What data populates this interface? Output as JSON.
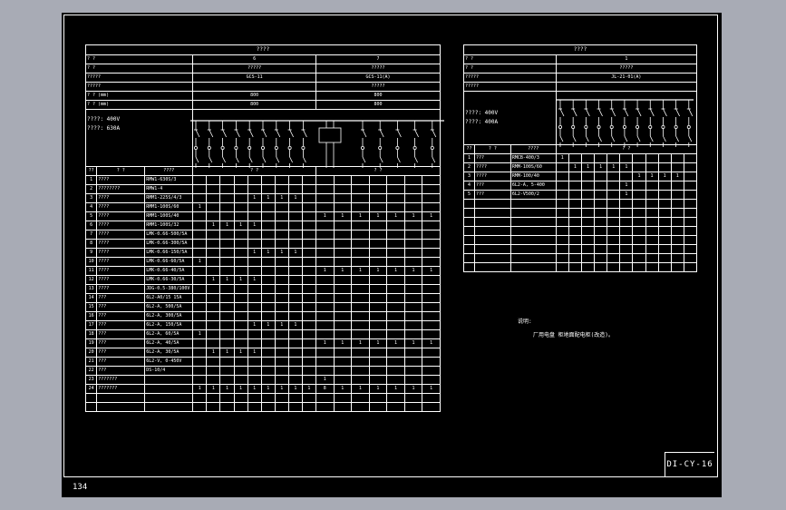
{
  "page_number": "134",
  "drawing_no": "DI-CY-16",
  "left_table": {
    "title": "????",
    "header_rows": [
      {
        "label": "? ?",
        "a": "6",
        "b": "7"
      },
      {
        "label": "? ?",
        "a": "?????",
        "b": "?????"
      },
      {
        "label": "?????",
        "a": "GCS-11",
        "b": "GCS-11(A)"
      },
      {
        "label": "?????",
        "a": "",
        "b": "?????"
      },
      {
        "label": "? ? (mm)",
        "a": "800",
        "b": "800"
      },
      {
        "label": "? ? (mm)",
        "a": "800",
        "b": "800"
      }
    ],
    "spec_lines": [
      "????: 400V",
      "????: 630A"
    ],
    "col_headers": {
      "no": "??",
      "name": "? ?",
      "model": "????",
      "qa": "? ?",
      "qb": "? ?"
    },
    "rows": [
      {
        "no": "1",
        "name": "????",
        "model": "RMW1-630S/3",
        "a": [
          "",
          "",
          "",
          "",
          "",
          "",
          "",
          "",
          ""
        ],
        "b": [
          "",
          "",
          "",
          "",
          "",
          "",
          ""
        ]
      },
      {
        "no": "2",
        "name": "????????",
        "model": "RMW1-4",
        "a": [
          "",
          "",
          "",
          "",
          "",
          "",
          "",
          "",
          ""
        ],
        "b": [
          "",
          "",
          "",
          "",
          "",
          "",
          ""
        ]
      },
      {
        "no": "3",
        "name": "????",
        "model": "RMM1-225S/4/3",
        "a": [
          "",
          "",
          "",
          "",
          "1",
          "1",
          "1",
          "1",
          ""
        ],
        "b": [
          "",
          "",
          "",
          "",
          "",
          "",
          ""
        ]
      },
      {
        "no": "4",
        "name": "????",
        "model": "RMM1-100S/60",
        "a": [
          "1",
          "",
          "",
          "",
          "",
          "",
          "",
          "",
          ""
        ],
        "b": [
          "",
          "",
          "",
          "",
          "",
          "",
          ""
        ]
      },
      {
        "no": "5",
        "name": "????",
        "model": "RMM1-100S/40",
        "a": [
          "",
          "",
          "",
          "",
          "",
          "",
          "",
          "",
          ""
        ],
        "b": [
          "1",
          "1",
          "1",
          "1",
          "1",
          "1",
          "1"
        ]
      },
      {
        "no": "6",
        "name": "????",
        "model": "RMM1-100S/32",
        "a": [
          "",
          "1",
          "1",
          "1",
          "1",
          "",
          "",
          "",
          ""
        ],
        "b": [
          "",
          "",
          "",
          "",
          "",
          "",
          ""
        ]
      },
      {
        "no": "7",
        "name": "????",
        "model": "LMK-0.66-500/5A",
        "a": [
          "",
          "",
          "",
          "",
          "",
          "",
          "",
          "",
          ""
        ],
        "b": [
          "",
          "",
          "",
          "",
          "",
          "",
          ""
        ]
      },
      {
        "no": "8",
        "name": "????",
        "model": "LMK-0.66-300/5A",
        "a": [
          "",
          "",
          "",
          "",
          "",
          "",
          "",
          "",
          ""
        ],
        "b": [
          "",
          "",
          "",
          "",
          "",
          "",
          ""
        ]
      },
      {
        "no": "9",
        "name": "????",
        "model": "LMK-0.66-150/5A",
        "a": [
          "",
          "",
          "",
          "",
          "1",
          "1",
          "1",
          "1",
          ""
        ],
        "b": [
          "",
          "",
          "",
          "",
          "",
          "",
          ""
        ]
      },
      {
        "no": "10",
        "name": "????",
        "model": "LMK-0.66-60/5A",
        "a": [
          "1",
          "",
          "",
          "",
          "",
          "",
          "",
          "",
          ""
        ],
        "b": [
          "",
          "",
          "",
          "",
          "",
          "",
          ""
        ]
      },
      {
        "no": "11",
        "name": "????",
        "model": "LMK-0.66-40/5A",
        "a": [
          "",
          "",
          "",
          "",
          "",
          "",
          "",
          "",
          ""
        ],
        "b": [
          "1",
          "1",
          "1",
          "1",
          "1",
          "1",
          "1"
        ]
      },
      {
        "no": "12",
        "name": "????",
        "model": "LMK-0.66-30/5A",
        "a": [
          "",
          "1",
          "1",
          "1",
          "1",
          "",
          "",
          "",
          ""
        ],
        "b": [
          "",
          "",
          "",
          "",
          "",
          "",
          ""
        ]
      },
      {
        "no": "13",
        "name": "????",
        "model": "JDG-0.5-380/100V",
        "a": [
          "",
          "",
          "",
          "",
          "",
          "",
          "",
          "",
          ""
        ],
        "b": [
          "",
          "",
          "",
          "",
          "",
          "",
          ""
        ]
      },
      {
        "no": "14",
        "name": "???",
        "model": "6L2-A0/15 15A",
        "a": [
          "",
          "",
          "",
          "",
          "",
          "",
          "",
          "",
          ""
        ],
        "b": [
          "",
          "",
          "",
          "",
          "",
          "",
          ""
        ]
      },
      {
        "no": "15",
        "name": "???",
        "model": "6L2-A, 500/5A",
        "a": [
          "",
          "",
          "",
          "",
          "",
          "",
          "",
          "",
          ""
        ],
        "b": [
          "",
          "",
          "",
          "",
          "",
          "",
          ""
        ]
      },
      {
        "no": "16",
        "name": "???",
        "model": "6L2-A, 300/5A",
        "a": [
          "",
          "",
          "",
          "",
          "",
          "",
          "",
          "",
          ""
        ],
        "b": [
          "",
          "",
          "",
          "",
          "",
          "",
          ""
        ]
      },
      {
        "no": "17",
        "name": "???",
        "model": "6L2-A, 150/5A",
        "a": [
          "",
          "",
          "",
          "",
          "1",
          "1",
          "1",
          "1",
          ""
        ],
        "b": [
          "",
          "",
          "",
          "",
          "",
          "",
          ""
        ]
      },
      {
        "no": "18",
        "name": "???",
        "model": "6L2-A, 60/5A",
        "a": [
          "1",
          "",
          "",
          "",
          "",
          "",
          "",
          "",
          ""
        ],
        "b": [
          "",
          "",
          "",
          "",
          "",
          "",
          ""
        ]
      },
      {
        "no": "19",
        "name": "???",
        "model": "6L2-A, 40/5A",
        "a": [
          "",
          "",
          "",
          "",
          "",
          "",
          "",
          "",
          ""
        ],
        "b": [
          "1",
          "1",
          "1",
          "1",
          "1",
          "1",
          "1"
        ]
      },
      {
        "no": "20",
        "name": "???",
        "model": "6L2-A, 30/5A",
        "a": [
          "",
          "1",
          "1",
          "1",
          "1",
          "",
          "",
          "",
          ""
        ],
        "b": [
          "",
          "",
          "",
          "",
          "",
          "",
          ""
        ]
      },
      {
        "no": "21",
        "name": "???",
        "model": "6L2-V, 0-450V",
        "a": [
          "",
          "",
          "",
          "",
          "",
          "",
          "",
          "",
          ""
        ],
        "b": [
          "",
          "",
          "",
          "",
          "",
          "",
          ""
        ]
      },
      {
        "no": "22",
        "name": "???",
        "model": "DS-10/4",
        "a": [
          "",
          "",
          "",
          "",
          "",
          "",
          "",
          "",
          ""
        ],
        "b": [
          "",
          "",
          "",
          "",
          "",
          "",
          ""
        ]
      },
      {
        "no": "23",
        "name": "???????",
        "model": "",
        "a": [
          "",
          "",
          "",
          "",
          "",
          "",
          "",
          "",
          ""
        ],
        "b": [
          "1",
          "",
          "",
          "",
          "",
          "",
          ""
        ]
      },
      {
        "no": "24",
        "name": "???????",
        "model": "",
        "a": [
          "1",
          "1",
          "1",
          "1",
          "1",
          "1",
          "1",
          "1",
          "1"
        ],
        "b": [
          "8",
          "1",
          "1",
          "1",
          "1",
          "1",
          "1"
        ]
      },
      {
        "no": "",
        "name": "",
        "model": "",
        "a": [
          "",
          "",
          "",
          "",
          "",
          "",
          "",
          "",
          ""
        ],
        "b": [
          "",
          "",
          "",
          "",
          "",
          "",
          ""
        ]
      },
      {
        "no": "",
        "name": "",
        "model": "",
        "a": [
          "",
          "",
          "",
          "",
          "",
          "",
          "",
          "",
          ""
        ],
        "b": [
          "",
          "",
          "",
          "",
          "",
          "",
          ""
        ]
      }
    ]
  },
  "right_table": {
    "title": "????",
    "header_rows": [
      {
        "label": "? ?",
        "value": "1"
      },
      {
        "label": "? ?",
        "value": "?????"
      },
      {
        "label": "?????",
        "value": "JL-21-01(A)"
      },
      {
        "label": "?????",
        "value": ""
      }
    ],
    "spec_lines": [
      "????: 400V",
      "????: 400A"
    ],
    "col_headers": {
      "no": "??",
      "name": "? ?",
      "model": "????",
      "qty": "? ?"
    },
    "rows": [
      {
        "no": "1",
        "name": "???",
        "model": "RMCB-400/3",
        "q": [
          "1",
          "",
          "",
          "",
          "",
          "",
          "",
          "",
          "",
          "",
          ""
        ]
      },
      {
        "no": "2",
        "name": "????",
        "model": "RMM-100S/60",
        "q": [
          "",
          "1",
          "1",
          "1",
          "1",
          "1",
          "",
          "",
          "",
          "",
          ""
        ]
      },
      {
        "no": "3",
        "name": "????",
        "model": "RMM-100/40",
        "q": [
          "",
          "",
          "",
          "",
          "",
          "",
          "1",
          "1",
          "1",
          "1",
          ""
        ]
      },
      {
        "no": "4",
        "name": "???",
        "model": "6L2-A, 5-400",
        "q": [
          "",
          "",
          "",
          "",
          "",
          "1",
          "",
          "",
          "",
          "",
          ""
        ]
      },
      {
        "no": "5",
        "name": "???",
        "model": "6L2-V500/2",
        "q": [
          "",
          "",
          "",
          "",
          "",
          "1",
          "",
          "",
          "",
          "",
          ""
        ]
      },
      {
        "no": "",
        "name": "",
        "model": "",
        "q": [
          "",
          "",
          "",
          "",
          "",
          "",
          "",
          "",
          "",
          "",
          ""
        ]
      },
      {
        "no": "",
        "name": "",
        "model": "",
        "q": [
          "",
          "",
          "",
          "",
          "",
          "",
          "",
          "",
          "",
          "",
          ""
        ]
      },
      {
        "no": "",
        "name": "",
        "model": "",
        "q": [
          "",
          "",
          "",
          "",
          "",
          "",
          "",
          "",
          "",
          "",
          ""
        ]
      },
      {
        "no": "",
        "name": "",
        "model": "",
        "q": [
          "",
          "",
          "",
          "",
          "",
          "",
          "",
          "",
          "",
          "",
          ""
        ]
      },
      {
        "no": "",
        "name": "",
        "model": "",
        "q": [
          "",
          "",
          "",
          "",
          "",
          "",
          "",
          "",
          "",
          "",
          ""
        ]
      },
      {
        "no": "",
        "name": "",
        "model": "",
        "q": [
          "",
          "",
          "",
          "",
          "",
          "",
          "",
          "",
          "",
          "",
          ""
        ]
      },
      {
        "no": "",
        "name": "",
        "model": "",
        "q": [
          "",
          "",
          "",
          "",
          "",
          "",
          "",
          "",
          "",
          "",
          ""
        ]
      },
      {
        "no": "",
        "name": "",
        "model": "",
        "q": [
          "",
          "",
          "",
          "",
          "",
          "",
          "",
          "",
          "",
          "",
          ""
        ]
      }
    ]
  },
  "notes": {
    "title": "说明:",
    "line": "厂用电盘 柜地面配电柜(改造)。"
  }
}
